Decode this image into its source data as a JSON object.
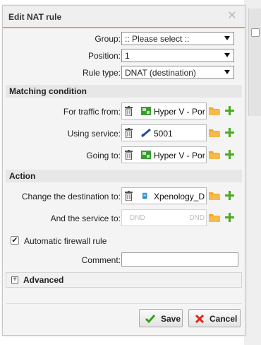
{
  "dialog": {
    "title": "Edit NAT rule",
    "close_glyph": "✕"
  },
  "fields": {
    "group": {
      "label": "Group:",
      "value": ":: Please select ::"
    },
    "position": {
      "label": "Position:",
      "value": "1"
    },
    "rule_type": {
      "label": "Rule type:",
      "value": "DNAT (destination)"
    }
  },
  "matching": {
    "heading": "Matching condition",
    "traffic_from": {
      "label": "For traffic from:",
      "value": "Hyper V - Por",
      "icon": "network-icon"
    },
    "using_service": {
      "label": "Using service:",
      "value": "5001",
      "icon": "service-icon"
    },
    "going_to": {
      "label": "Going to:",
      "value": "Hyper V - Por",
      "icon": "network-icon"
    }
  },
  "action": {
    "heading": "Action",
    "change_dest": {
      "label": "Change the destination to:",
      "value": "Xpenology_D",
      "icon": "host-icon"
    },
    "and_service": {
      "label": "And the service to:",
      "placeholder_left": "DND",
      "placeholder_right": "DND"
    }
  },
  "auto_firewall": {
    "label": "Automatic firewall rule",
    "checked": true,
    "check_glyph": "✔"
  },
  "comment": {
    "label": "Comment:",
    "value": ""
  },
  "advanced": {
    "label": "Advanced",
    "expand_glyph": "+"
  },
  "buttons": {
    "save": "Save",
    "cancel": "Cancel"
  },
  "colors": {
    "accent": "#f0a030",
    "plus_green": "#4caa1e",
    "folder_orange": "#f5a623",
    "cancel_red": "#d9261c"
  }
}
